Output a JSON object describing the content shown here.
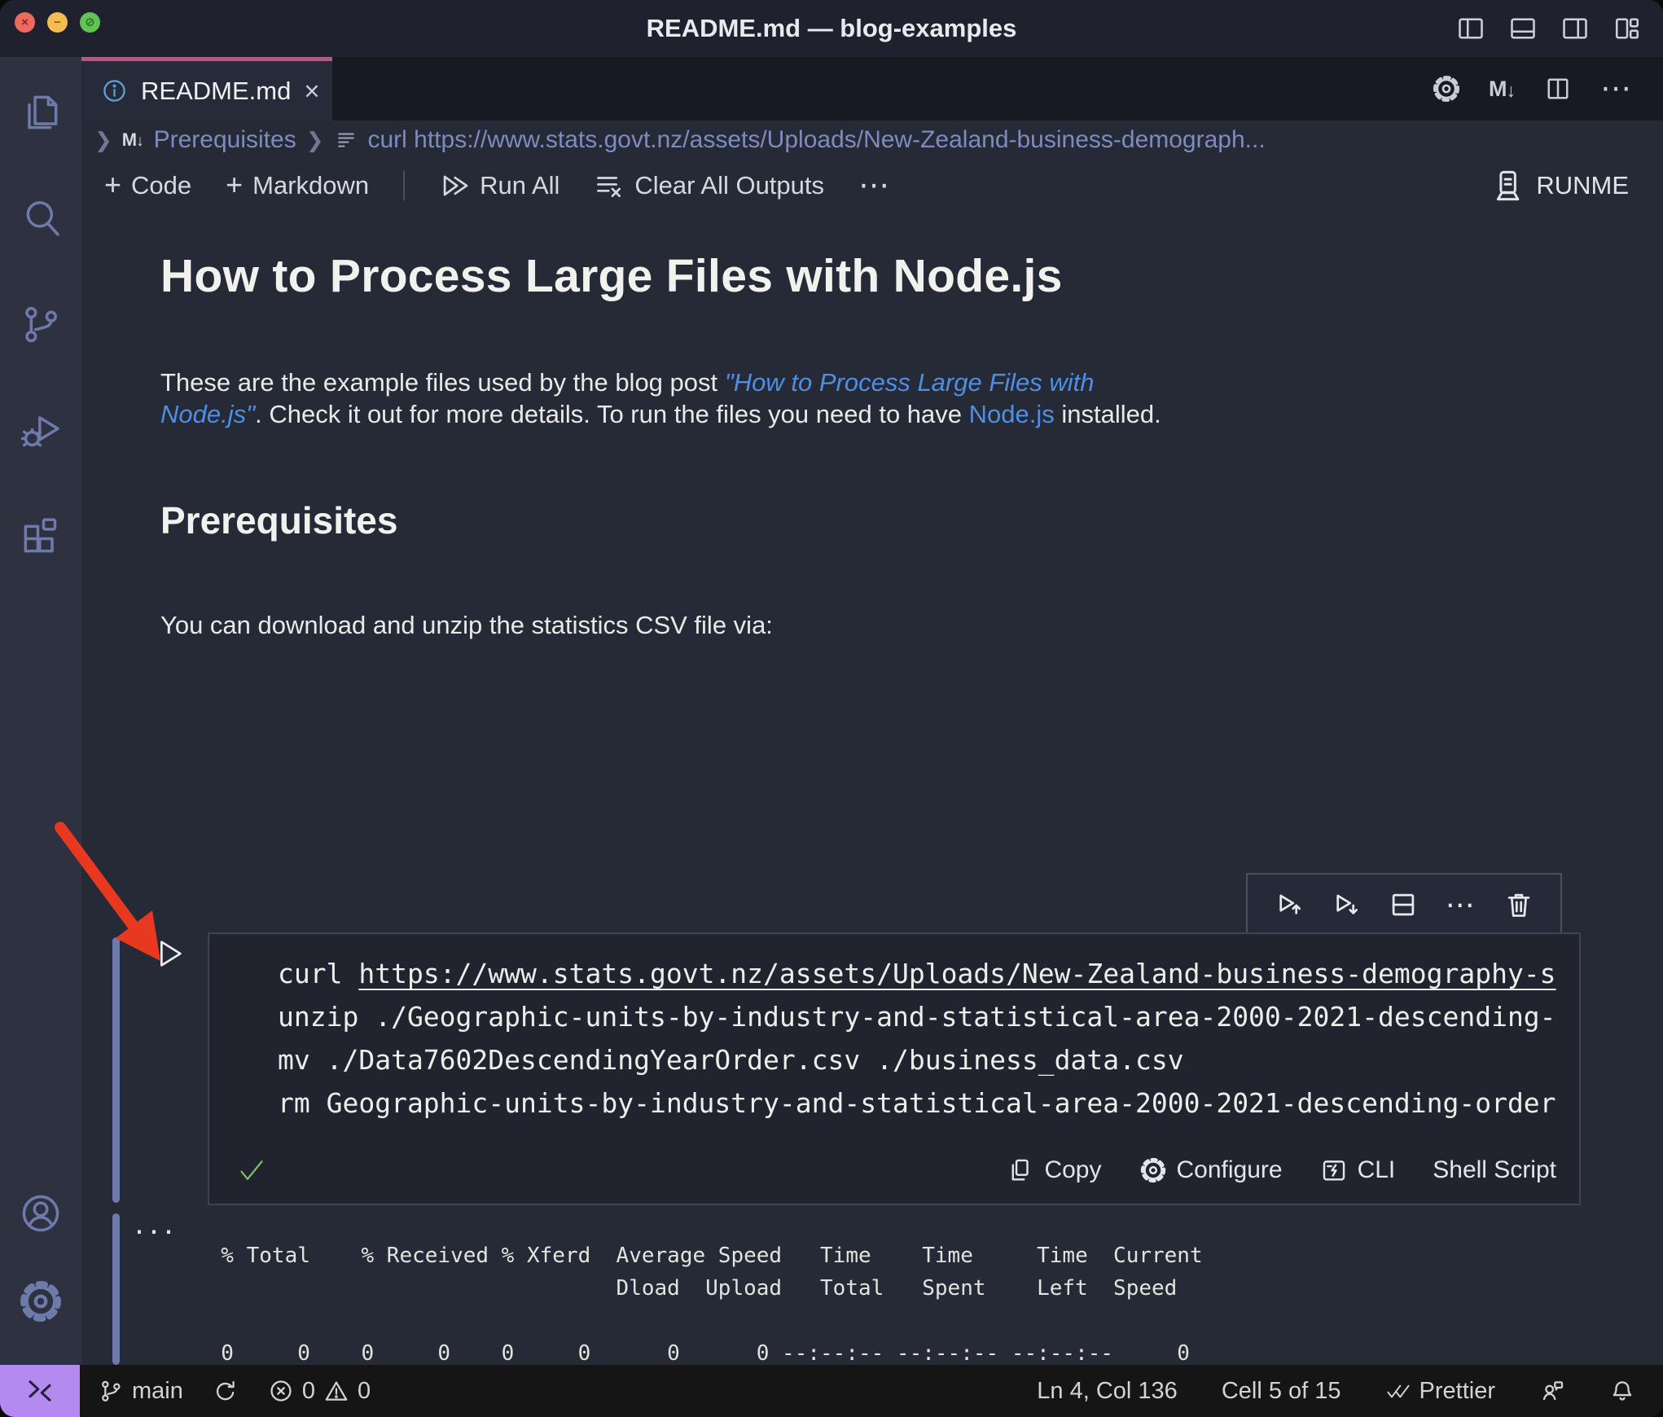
{
  "window": {
    "title": "README.md — blog-examples"
  },
  "tab": {
    "label": "README.md"
  },
  "breadcrumb": {
    "root": "Prerequisites",
    "cell": "curl https://www.stats.govt.nz/assets/Uploads/New-Zealand-business-demograph..."
  },
  "toolbar": {
    "add_code": "Code",
    "add_markdown": "Markdown",
    "run_all": "Run All",
    "clear_outputs": "Clear All Outputs",
    "runme": "RUNME"
  },
  "doc": {
    "h1": "How to Process Large Files with Node.js",
    "p1": {
      "prefix": "These are the example files used by the blog post ",
      "link1a": "\"How to Process Large Files with",
      "link1b": "Node.js\"",
      "mid": ". Check it out for more details. To run the files you need to have ",
      "link2": "Node.js",
      "suffix": " installed."
    },
    "h2": "Prerequisites",
    "p2": "You can download and unzip the statistics CSV file via:"
  },
  "cell": {
    "code": {
      "l1cmd": "curl ",
      "l1url": "https://www.stats.govt.nz/assets/Uploads/New-Zealand-business-demography-s",
      "l2": "unzip ./Geographic-units-by-industry-and-statistical-area-2000-2021-descending-",
      "l3": "mv ./Data7602DescendingYearOrder.csv ./business_data.csv",
      "l4": "rm Geographic-units-by-industry-and-statistical-area-2000-2021-descending-order"
    },
    "footer": {
      "copy": "Copy",
      "configure": "Configure",
      "cli": "CLI",
      "language": "Shell Script"
    }
  },
  "output": {
    "header1": "  % Total    % Received % Xferd  Average Speed   Time    Time     Time  Current",
    "header2": "                                 Dload  Upload   Total   Spent    Left  Speed",
    "progress": "  0     0    0     0    0     0      0      0 --:--:-- --:--:-- --:--:--     0"
  },
  "status": {
    "branch": "main",
    "errors": "0",
    "warnings": "0",
    "line_col": "Ln 4, Col 136",
    "cell_indicator": "Cell 5 of 15",
    "formatter": "Prettier"
  },
  "colors": {
    "tab_accent": "#a4627f",
    "remote_purple": "#b48af0",
    "link_blue": "#4e8fe3",
    "success_green": "#7cc36e",
    "annotation_arrow_red": "#e8381f"
  }
}
